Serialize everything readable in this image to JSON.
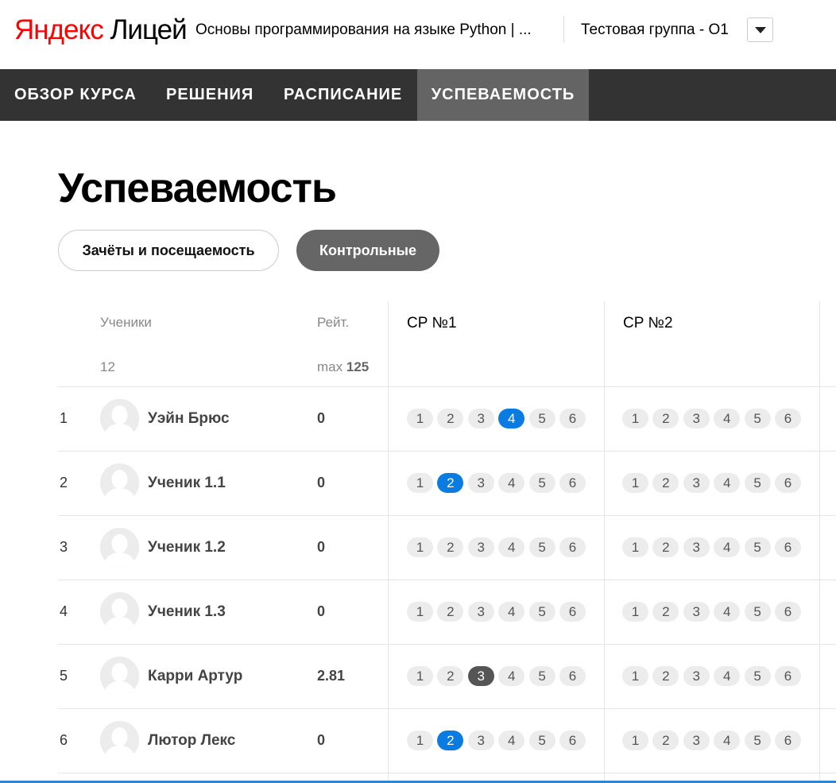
{
  "header": {
    "logo_part1": "Яндекс",
    "logo_part2": "Лицей",
    "course_title": "Основы программирования на языке Python | ...",
    "group_name": "Тестовая группа - О1"
  },
  "nav": {
    "tabs": [
      {
        "label": "ОБЗОР КУРСА",
        "active": false
      },
      {
        "label": "РЕШЕНИЯ",
        "active": false
      },
      {
        "label": "РАСПИСАНИЕ",
        "active": false
      },
      {
        "label": "УСПЕВАЕМОСТЬ",
        "active": true
      }
    ]
  },
  "page": {
    "title": "Успеваемость",
    "tabs": [
      {
        "label": "Зачёты и посещаемость",
        "active": false
      },
      {
        "label": "Контрольные",
        "active": true
      }
    ]
  },
  "table": {
    "students_header": "Ученики",
    "students_count": "12",
    "rating_header": "Рейт.",
    "max_label": "max",
    "max_value": "125",
    "columns": [
      "СР №1",
      "СР №2"
    ],
    "variant_labels": [
      "1",
      "2",
      "3",
      "4",
      "5",
      "6"
    ],
    "rows": [
      {
        "index": "1",
        "name": "Уэйн Брюс",
        "rating": "0",
        "sr1_selected": 4,
        "sr1_state": "blue",
        "sr2_selected": 0,
        "sr2_state": ""
      },
      {
        "index": "2",
        "name": "Ученик 1.1",
        "rating": "0",
        "sr1_selected": 2,
        "sr1_state": "blue",
        "sr2_selected": 0,
        "sr2_state": ""
      },
      {
        "index": "3",
        "name": "Ученик 1.2",
        "rating": "0",
        "sr1_selected": 0,
        "sr1_state": "",
        "sr2_selected": 0,
        "sr2_state": ""
      },
      {
        "index": "4",
        "name": "Ученик 1.3",
        "rating": "0",
        "sr1_selected": 0,
        "sr1_state": "",
        "sr2_selected": 0,
        "sr2_state": ""
      },
      {
        "index": "5",
        "name": "Карри Артур",
        "rating": "2.81",
        "sr1_selected": 3,
        "sr1_state": "dark",
        "sr2_selected": 0,
        "sr2_state": ""
      },
      {
        "index": "6",
        "name": "Лютор Лекс",
        "rating": "0",
        "sr1_selected": 2,
        "sr1_state": "blue",
        "sr2_selected": 0,
        "sr2_state": ""
      }
    ]
  },
  "colors": {
    "accent_blue": "#0a7be0",
    "dark_chip": "#555555",
    "nav_bg": "#333333",
    "nav_active": "#646464",
    "logo_red": "#ff0000"
  }
}
